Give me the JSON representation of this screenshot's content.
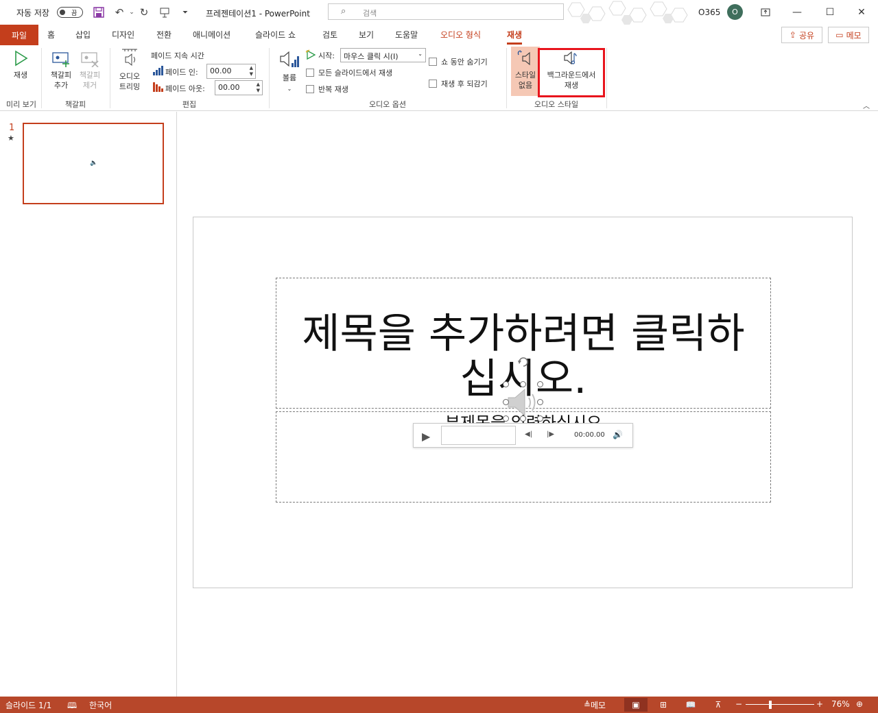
{
  "titlebar": {
    "autosave_label": "자동 저장",
    "autosave_state": "끔",
    "doc_title": "프레젠테이션1 - PowerPoint",
    "search_placeholder": "검색",
    "account": "O365",
    "avatar_initial": "O"
  },
  "tabs": [
    {
      "label": "파일"
    },
    {
      "label": "홈"
    },
    {
      "label": "삽입"
    },
    {
      "label": "디자인"
    },
    {
      "label": "전환"
    },
    {
      "label": "애니메이션"
    },
    {
      "label": "슬라이드 쇼"
    },
    {
      "label": "검토"
    },
    {
      "label": "보기"
    },
    {
      "label": "도움말"
    },
    {
      "label": "오디오 형식"
    },
    {
      "label": "재생"
    }
  ],
  "share_label": "공유",
  "memo_label": "메모",
  "ribbon": {
    "preview": {
      "play_label": "재생",
      "group": "미리 보기"
    },
    "bookmarks": {
      "add_line1": "책갈피",
      "add_line2": "추가",
      "remove_line1": "책갈피",
      "remove_line2": "제거",
      "group": "책갈피"
    },
    "editing": {
      "trim_line1": "오디오",
      "trim_line2": "트리밍",
      "fade_duration": "페이드 지속 시간",
      "fade_in_label": "페이드 인:",
      "fade_in_value": "00.00",
      "fade_out_label": "페이드 아웃:",
      "fade_out_value": "00.00",
      "group": "편집"
    },
    "audio_options": {
      "volume_label": "볼륨",
      "start_label": "시작:",
      "start_value": "마우스 클릭 시(I)",
      "play_across": "모든 슬라이드에서 재생",
      "loop": "반복 재생",
      "hide_during_show": "쇼 동안 숨기기",
      "rewind": "재생 후 되감기",
      "group": "오디오 옵션"
    },
    "audio_styles": {
      "none_line1": "스타일",
      "none_line2": "없음",
      "bg_line1": "백그라운드에서",
      "bg_line2": "재생",
      "group": "오디오 스타일"
    }
  },
  "thumbs": {
    "number": "1",
    "star": "★"
  },
  "slide": {
    "title_line1": "제목을 추가하려면 클릭하",
    "title_line2": "십시오.",
    "subtitle": "부제목을 입력하십시오"
  },
  "player": {
    "time": "00:00.00"
  },
  "status": {
    "slide_count": "슬라이드 1/1",
    "language": "한국어",
    "notes": "메모",
    "zoom": "76%"
  },
  "colors": {
    "accent": "#c43e1c",
    "statusbar": "#b7472a",
    "highlight": "#e8141c"
  }
}
